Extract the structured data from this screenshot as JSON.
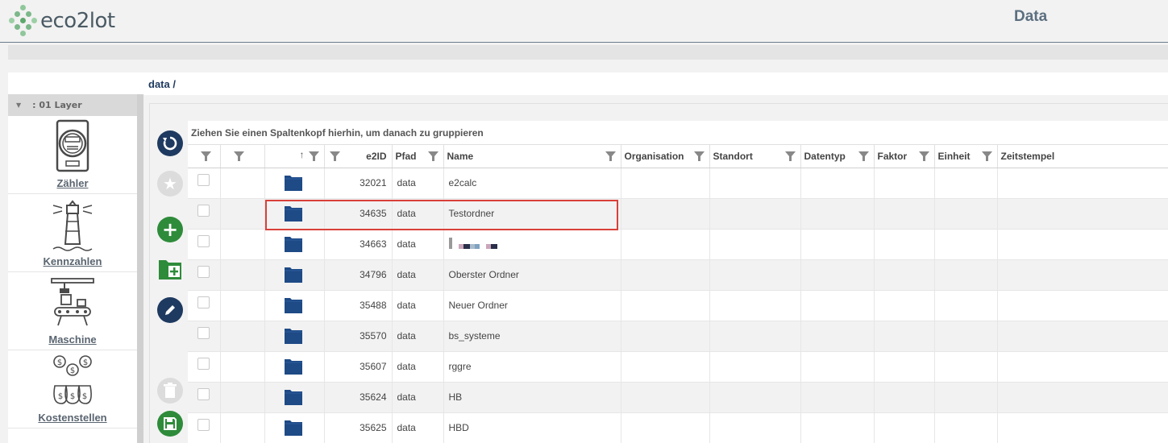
{
  "app": {
    "logo_text": "eco2lot",
    "page_heading": "Data"
  },
  "sidebar": {
    "layer_label": ": 01 Layer",
    "items": [
      {
        "label": "Zähler",
        "icon": "meter-icon"
      },
      {
        "label": "Kennzahlen",
        "icon": "lighthouse-icon"
      },
      {
        "label": "Maschine",
        "icon": "machine-icon"
      },
      {
        "label": "Kostenstellen",
        "icon": "money-bags-icon"
      }
    ]
  },
  "breadcrumb": {
    "path": "data /"
  },
  "grid": {
    "group_hint": "Ziehen Sie einen Spaltenkopf hierhin, um danach zu gruppieren",
    "columns": [
      "e2ID",
      "Pfad",
      "Name",
      "Organisation",
      "Standort",
      "Datentyp",
      "Faktor",
      "Einheit",
      "Zeitstempel"
    ],
    "sort_arrow": "↑",
    "rows": [
      {
        "e2id": "32021",
        "pfad": "data",
        "name": "e2calc"
      },
      {
        "e2id": "34635",
        "pfad": "data",
        "name": "Testordner"
      },
      {
        "e2id": "34663",
        "pfad": "data",
        "name": ""
      },
      {
        "e2id": "34796",
        "pfad": "data",
        "name": "Oberster Ordner"
      },
      {
        "e2id": "35488",
        "pfad": "data",
        "name": "Neuer Ordner"
      },
      {
        "e2id": "35570",
        "pfad": "data",
        "name": "bs_systeme"
      },
      {
        "e2id": "35607",
        "pfad": "data",
        "name": "rggre"
      },
      {
        "e2id": "35624",
        "pfad": "data",
        "name": "HB"
      },
      {
        "e2id": "35625",
        "pfad": "data",
        "name": "HBD"
      }
    ]
  },
  "toolbar": {
    "buttons": [
      "refresh-icon",
      "star-icon",
      "add-icon",
      "add-folder-icon",
      "edit-icon",
      "delete-icon",
      "save-icon"
    ]
  },
  "colors": {
    "navy": "#1f3a60",
    "green": "#2e8b3a",
    "highlight": "#d9403a",
    "folder": "#1e4a86"
  }
}
